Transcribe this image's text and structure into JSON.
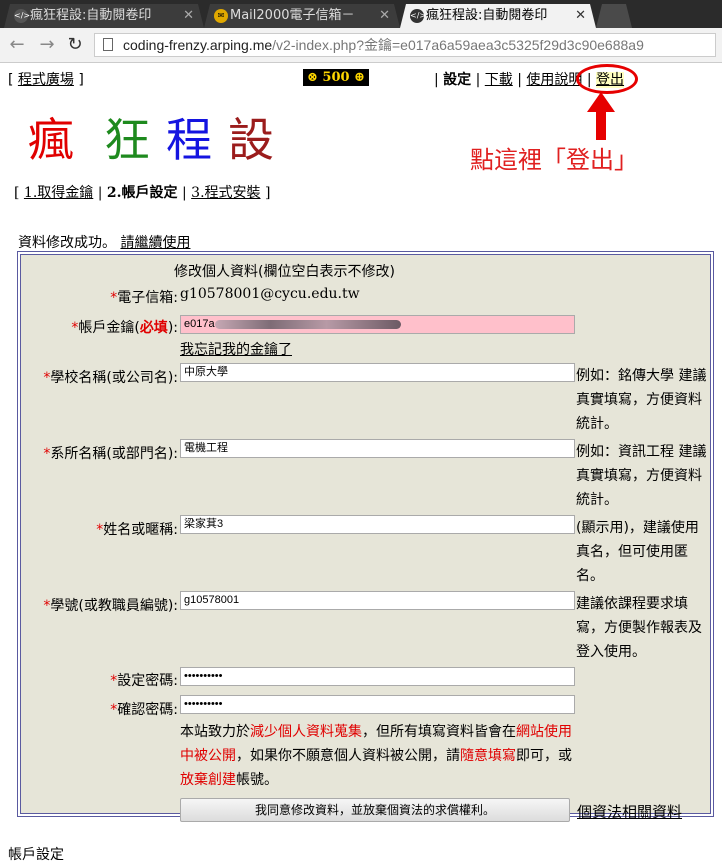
{
  "browser": {
    "tabs": [
      {
        "label": "瘋狂程設:自動閱卷印",
        "icon": "code-icon"
      },
      {
        "label": "Mail2000電子信箱－",
        "icon": "mail-icon"
      },
      {
        "label": "瘋狂程設:自動閱卷印",
        "icon": "code-icon"
      }
    ],
    "url_host": "coding-frenzy.arping.me",
    "url_path": "/v2-index.php?金鑰=e017a6a59aea3c5325f29d3c90e688a9"
  },
  "topnav": {
    "plaza": "程式廣場",
    "coins": "⊗ 500 ⊕",
    "settings": "設定",
    "download": "下載",
    "manual": "使用說明",
    "logout": "登出"
  },
  "logo": [
    "瘋",
    "狂",
    "程",
    "設"
  ],
  "logo_colors": [
    "#e00000",
    "#1e8a1e",
    "#1414e0",
    "#9b1c1c"
  ],
  "annotation": "點這裡「登出」",
  "steps": {
    "step1": "1.取得金鑰",
    "step2": "2.帳戶設定",
    "step3": "3.程式安裝"
  },
  "status": {
    "success": "資料修改成功。",
    "continue_link": "請繼續使用"
  },
  "form": {
    "title": "修改個人資料(欄位空白表示不修改)",
    "email_label": "電子信箱:",
    "email_value": "g10578001@cycu.edu.tw",
    "key_label": "帳戶金鑰(",
    "key_required": "必填",
    "key_label_end": "):",
    "key_value": "e017a",
    "forgot_key": "我忘記我的金鑰了",
    "school_label": "學校名稱(或公司名):",
    "school_value": "中原大學",
    "school_hint": "例如：銘傳大學 建議真實填寫，方便資料統計。",
    "dept_label": "系所名稱(或部門名):",
    "dept_value": "電機工程",
    "dept_hint": "例如：資訊工程 建議真實填寫，方便資料統計。",
    "name_label": "姓名或暱稱:",
    "name_value": "梁家萁3",
    "name_hint": "(顯示用)，建議使用真名，但可使用匿名。",
    "id_label": "學號(或教職員編號):",
    "id_value": "g10578001",
    "id_hint": "建議依課程要求填寫，方便製作報表及登入使用。",
    "pw_label": "設定密碼:",
    "pw_value": "••••••••••",
    "pw2_label": "確認密碼:",
    "pw2_value": "••••••••••",
    "notice_1": "本站致力於",
    "notice_red1": "減少個人資料蒐集",
    "notice_2": "，但所有填寫資料皆會在",
    "notice_red2": "網站使用中被公開",
    "notice_3": "，如果你不願意個人資料被公開，請",
    "notice_red3": "隨意填寫",
    "notice_4": "即可，或",
    "notice_red4": "放棄創建",
    "notice_5": "帳號。",
    "agree_button": "我同意修改資料，並放棄個資法的求償權利。",
    "privacy_link": "個資法相關資料"
  },
  "footer": "帳戶設定"
}
